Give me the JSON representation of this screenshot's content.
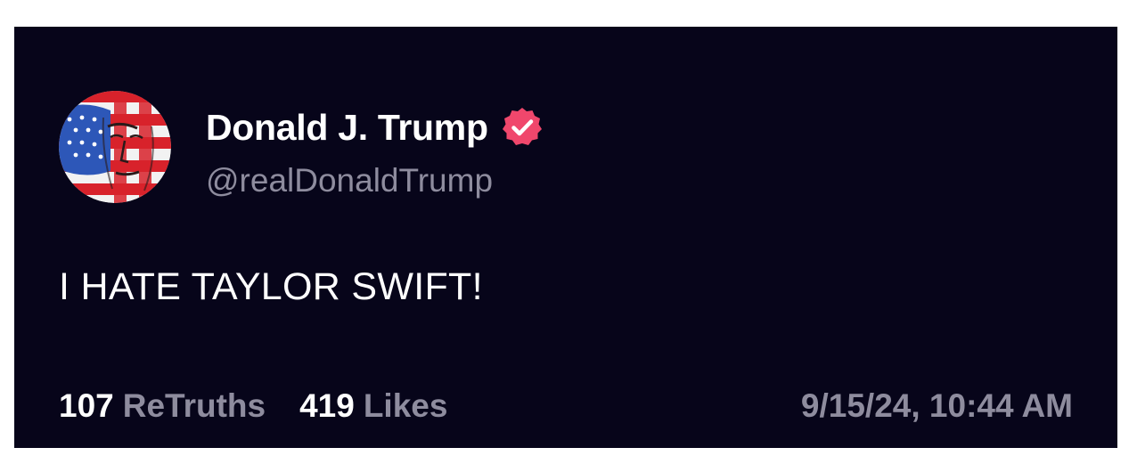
{
  "post": {
    "display_name": "Donald J. Trump",
    "handle": "@realDonaldTrump",
    "verified": true,
    "avatar_icon": "flag-face-avatar",
    "text": "I HATE TAYLOR SWIFT!",
    "retruths_count": "107",
    "retruths_label": "ReTruths",
    "likes_count": "419",
    "likes_label": "Likes",
    "timestamp": "9/15/24, 10:44 AM"
  },
  "colors": {
    "background": "#07051a",
    "text_primary": "#ffffff",
    "text_secondary": "#8e8c9e",
    "verified_badge": "#f0476c"
  }
}
